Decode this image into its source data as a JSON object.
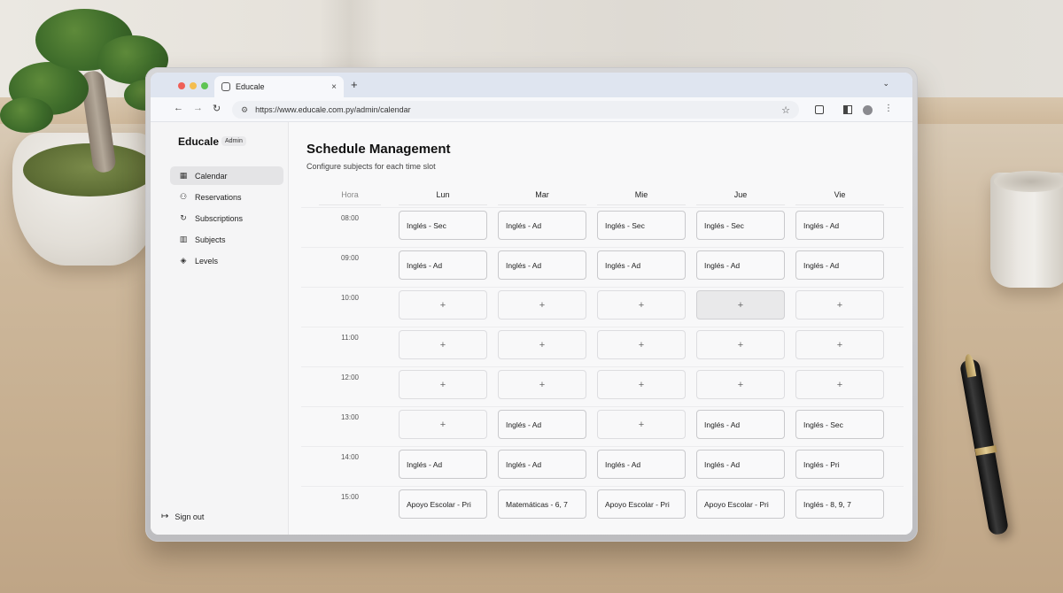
{
  "browser": {
    "tab_title": "Educale",
    "tab_close": "×",
    "new_tab": "+",
    "tab_menu": "⌄",
    "url": "https://www.educale.com.py/admin/calendar",
    "back": "←",
    "forward": "→",
    "reload": "↻",
    "star": "☆",
    "tune": "⚙",
    "menu": "⋮"
  },
  "sidebar": {
    "brand": "Educale",
    "badge": "Admin",
    "items": [
      {
        "label": "Calendar",
        "icon": "calendar-icon",
        "glyph": "▦",
        "active": true
      },
      {
        "label": "Reservations",
        "icon": "users-icon",
        "glyph": "⚇",
        "active": false
      },
      {
        "label": "Subscriptions",
        "icon": "refresh-icon",
        "glyph": "↻",
        "active": false
      },
      {
        "label": "Subjects",
        "icon": "book-icon",
        "glyph": "▥",
        "active": false
      },
      {
        "label": "Levels",
        "icon": "layers-icon",
        "glyph": "◈",
        "active": false
      }
    ],
    "sign_out": "Sign out",
    "sign_out_glyph": "↦"
  },
  "main": {
    "title": "Schedule Management",
    "subtitle": "Configure subjects for each time slot",
    "hora_label": "Hora",
    "add_glyph": "+",
    "days": [
      "Lun",
      "Mar",
      "Mie",
      "Jue",
      "Vie"
    ],
    "times": [
      "08:00",
      "09:00",
      "10:00",
      "11:00",
      "12:00",
      "13:00",
      "14:00",
      "15:00"
    ],
    "grid": [
      [
        "Inglés - Sec",
        "Inglés - Ad",
        "Inglés - Sec",
        "Inglés - Sec",
        "Inglés - Ad"
      ],
      [
        "Inglés - Ad",
        "Inglés - Ad",
        "Inglés - Ad",
        "Inglés - Ad",
        "Inglés - Ad"
      ],
      [
        "",
        "",
        "",
        "",
        ""
      ],
      [
        "",
        "",
        "",
        "",
        ""
      ],
      [
        "",
        "",
        "",
        "",
        ""
      ],
      [
        "",
        "Inglés - Ad",
        "",
        "Inglés - Ad",
        "Inglés - Sec"
      ],
      [
        "Inglés - Ad",
        "Inglés - Ad",
        "Inglés - Ad",
        "Inglés - Ad",
        "Inglés - Pri"
      ],
      [
        "Apoyo Escolar - Pri",
        "Matemáticas - 6, 7",
        "Apoyo Escolar - Pri",
        "Apoyo Escolar - Pri",
        "Inglés - 8, 9, 7"
      ]
    ]
  }
}
